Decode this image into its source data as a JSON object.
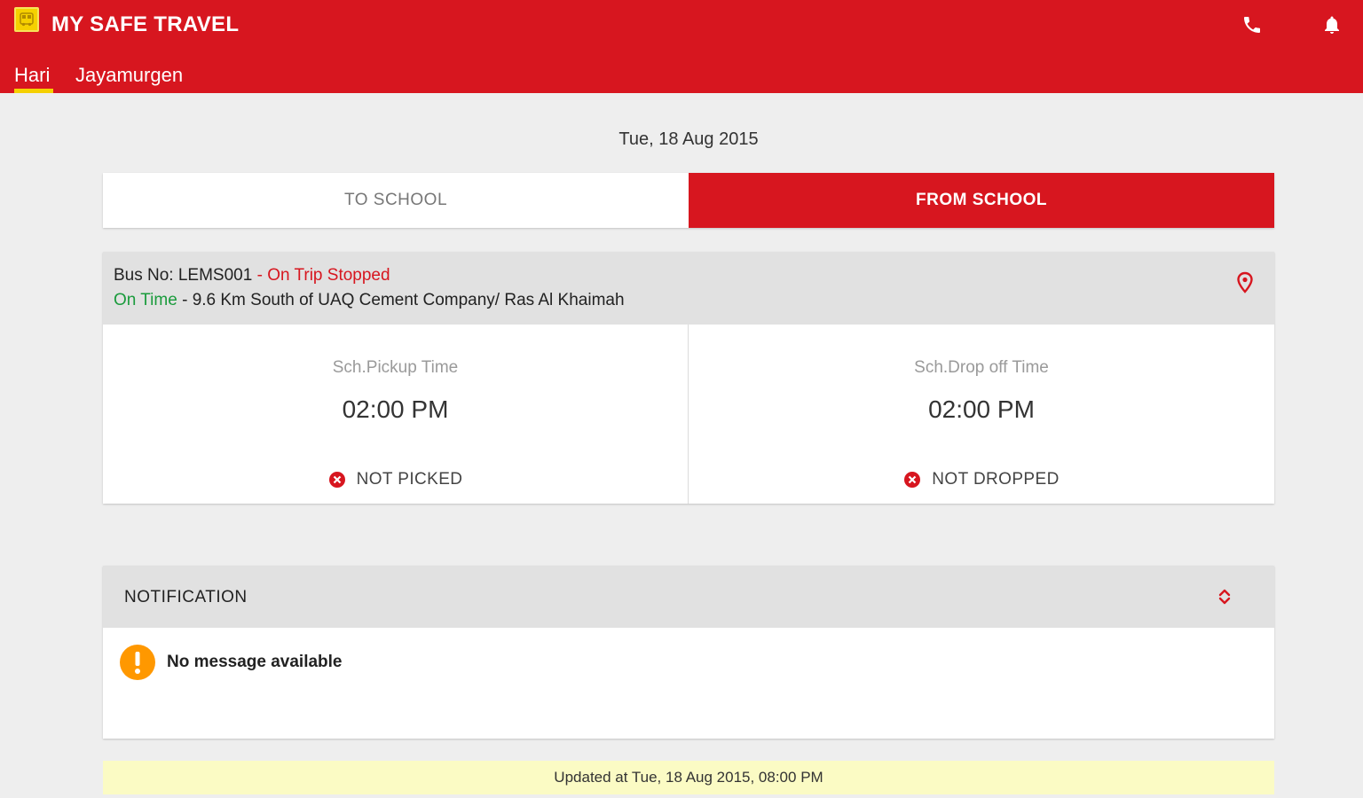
{
  "header": {
    "logo_icon": "school-bus-logo-icon",
    "title": "MY SAFE TRAVEL",
    "call_icon": "phone-icon",
    "notify_icon": "bell-icon",
    "tabs": [
      {
        "label": "Hari",
        "active": true
      },
      {
        "label": "Jayamurgen",
        "active": false
      }
    ]
  },
  "date": "Tue, 18 Aug 2015",
  "trip_toggle": {
    "to_school": "TO SCHOOL",
    "from_school": "FROM SCHOOL",
    "selected": "FROM SCHOOL"
  },
  "bus": {
    "bus_no_label": "Bus No: LEMS001",
    "separator": " - ",
    "trip_status": "On Trip Stopped",
    "timing_status": "On Time",
    "location": " - 9.6 Km South of UAQ Cement Company/ Ras Al Khaimah",
    "map_icon": "map-pin-icon"
  },
  "pickup": {
    "label": "Sch.Pickup Time",
    "time": "02:00 PM",
    "status": "NOT PICKED",
    "status_icon": "x-circle-icon"
  },
  "dropoff": {
    "label": "Sch.Drop off Time",
    "time": "02:00 PM",
    "status": "NOT DROPPED",
    "status_icon": "x-circle-icon"
  },
  "notification": {
    "title": "NOTIFICATION",
    "expand_icon": "sort-arrows-icon",
    "message_icon": "warning-icon",
    "message": "No message available"
  },
  "footer": {
    "updated": "Updated at Tue, 18 Aug 2015, 08:00 PM"
  },
  "colors": {
    "brand_red": "#d7161f",
    "accent_yellow": "#f5d000",
    "on_time_green": "#1a9b3c",
    "updated_bar": "#fbfbc4",
    "warning_orange": "#ff9800"
  }
}
